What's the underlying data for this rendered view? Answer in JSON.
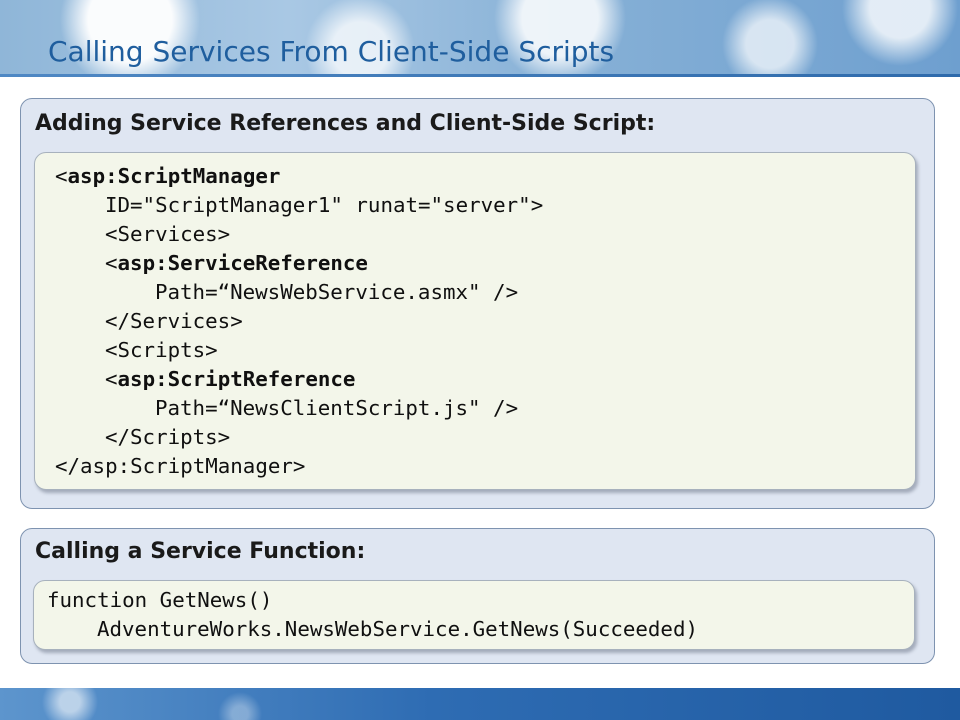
{
  "slide": {
    "title": "Calling Services From Client-Side Scripts"
  },
  "section_references": {
    "heading": "Adding Service References and Client-Side Script:",
    "code": {
      "line1_prefix": "<",
      "line1_tag": "asp:ScriptManager",
      "line2": "ID=\"ScriptManager1\" runat=\"server\">",
      "line3": "<Services>",
      "line4_prefix": "<",
      "line4_tag": "asp:ServiceReference",
      "line5": "Path=“NewsWebService.asmx\" />",
      "line6": "</Services>",
      "line7": "<Scripts>",
      "line8_prefix": "<",
      "line8_tag": "asp:ScriptReference",
      "line9": "Path=“NewsClientScript.js\" />",
      "line10": "</Scripts>",
      "line11": "</asp:ScriptManager>"
    }
  },
  "section_function": {
    "heading": "Calling a Service Function:",
    "code": {
      "line1": "function GetNews()",
      "line2": "AdventureWorks.NewsWebService.GetNews(Succeeded)"
    }
  },
  "colors": {
    "title_text": "#1f5e9e",
    "panel_background": "#dfe6f2",
    "code_background": "#f3f6ea",
    "header_accent": "#2e6aab"
  }
}
